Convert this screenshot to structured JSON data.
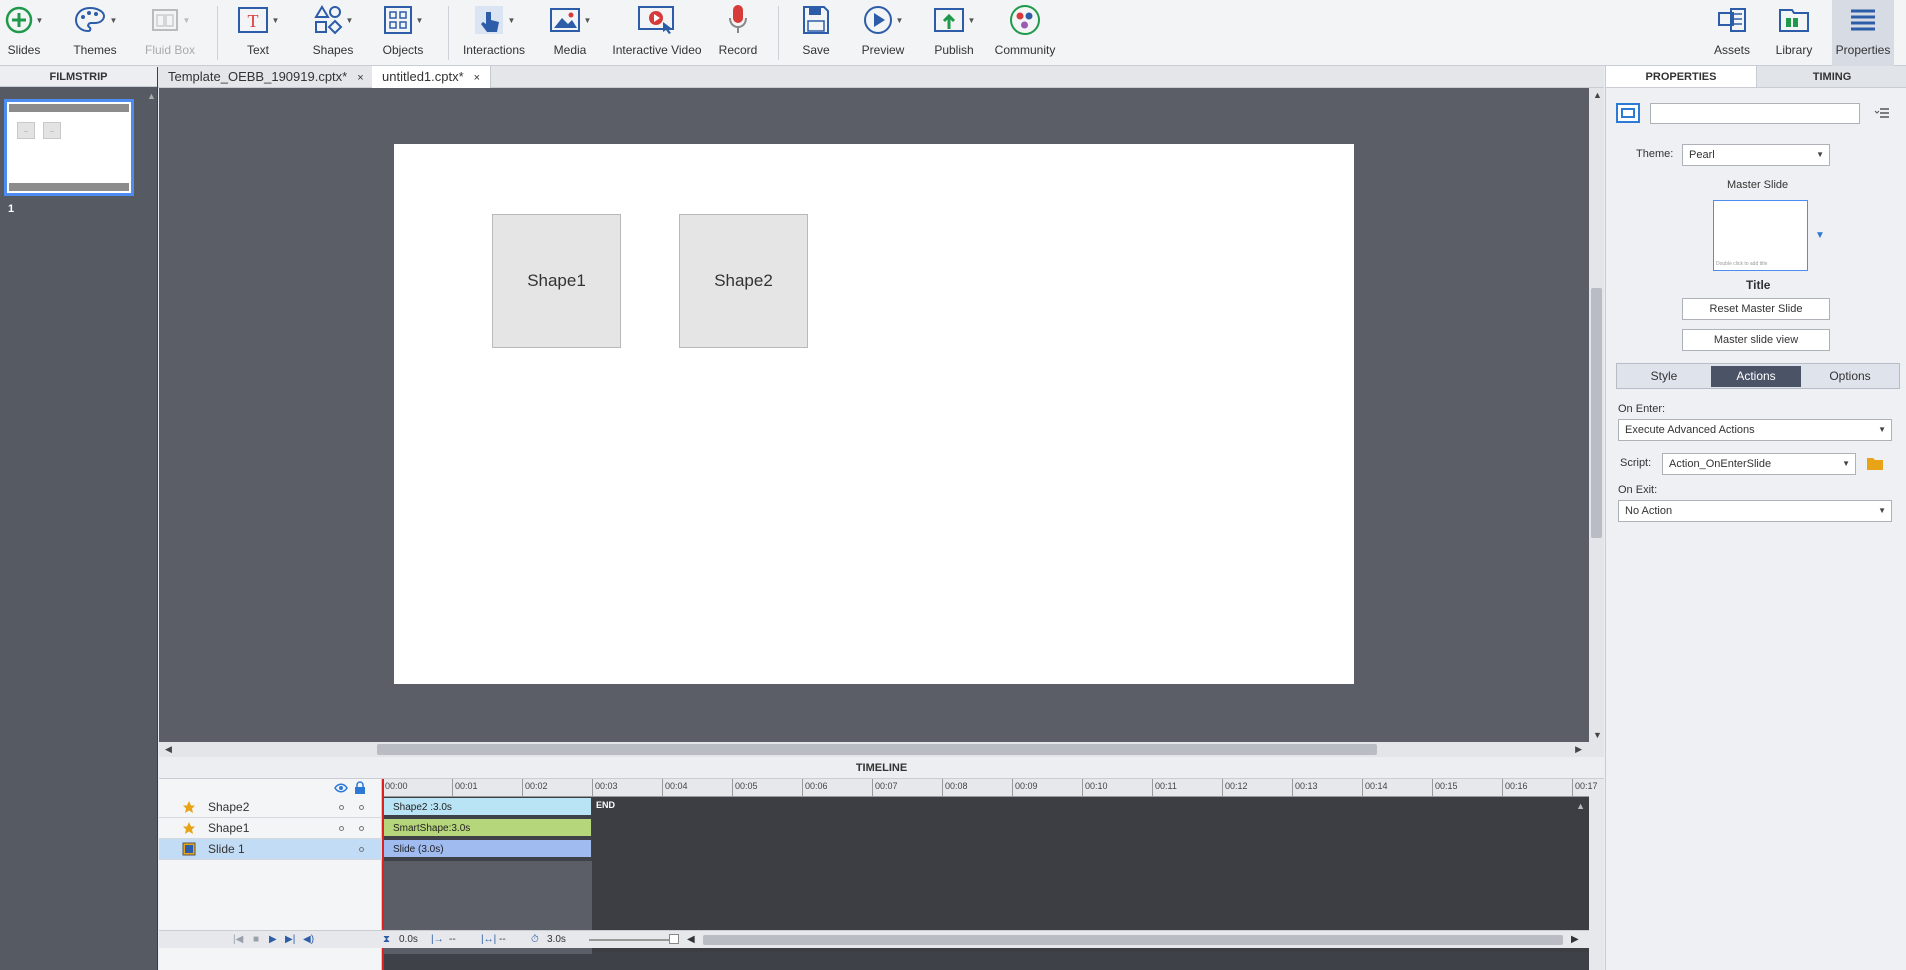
{
  "toolbar": {
    "slides": "Slides",
    "themes": "Themes",
    "fluid_box": "Fluid Box",
    "text": "Text",
    "shapes": "Shapes",
    "objects": "Objects",
    "interactions": "Interactions",
    "media": "Media",
    "interactive_video": "Interactive Video",
    "record": "Record",
    "save": "Save",
    "preview": "Preview",
    "publish": "Publish",
    "community": "Community",
    "assets": "Assets",
    "library": "Library",
    "properties": "Properties"
  },
  "filmstrip": {
    "title": "FILMSTRIP",
    "slide_number": "1"
  },
  "tabs": [
    {
      "label": "Template_OEBB_190919.cptx*",
      "close": "×"
    },
    {
      "label": "untitled1.cptx*",
      "close": "×"
    }
  ],
  "slide": {
    "shape1": "Shape1",
    "shape2": "Shape2"
  },
  "timeline": {
    "title": "TIMELINE",
    "rows": [
      {
        "name": "Shape2",
        "bar": "Shape2 :3.0s"
      },
      {
        "name": "Shape1",
        "bar": "SmartShape:3.0s"
      },
      {
        "name": "Slide 1",
        "bar": "Slide (3.0s)"
      }
    ],
    "ticks": [
      "00:00",
      "00:01",
      "00:02",
      "00:03",
      "00:04",
      "00:05",
      "00:06",
      "00:07",
      "00:08",
      "00:09",
      "00:10",
      "00:11",
      "00:12",
      "00:13",
      "00:14",
      "00:15",
      "00:16",
      "00:17"
    ],
    "end_label": "END",
    "footer": {
      "current_time": "0.0s",
      "start": "--",
      "duration": "--",
      "total": "3.0s"
    }
  },
  "properties": {
    "tab_properties": "PROPERTIES",
    "tab_timing": "TIMING",
    "name_value": "",
    "theme_label": "Theme:",
    "theme_value": "Pearl",
    "master_slide_label": "Master Slide",
    "master_thumb_text": "Double click to add title",
    "master_name": "Title",
    "reset_master": "Reset Master Slide",
    "master_view": "Master slide view",
    "seg_style": "Style",
    "seg_actions": "Actions",
    "seg_options": "Options",
    "on_enter_label": "On Enter:",
    "on_enter_value": "Execute Advanced Actions",
    "script_label": "Script:",
    "script_value": "Action_OnEnterSlide",
    "on_exit_label": "On Exit:",
    "on_exit_value": "No Action"
  },
  "colors": {
    "accent": "#4d8df2",
    "stage": "#5b5e66",
    "active_segment": "#4b5367",
    "bar_shape2": "#b9e4f5",
    "bar_shape1": "#b6d67c",
    "bar_slide": "#9fbbf0"
  }
}
